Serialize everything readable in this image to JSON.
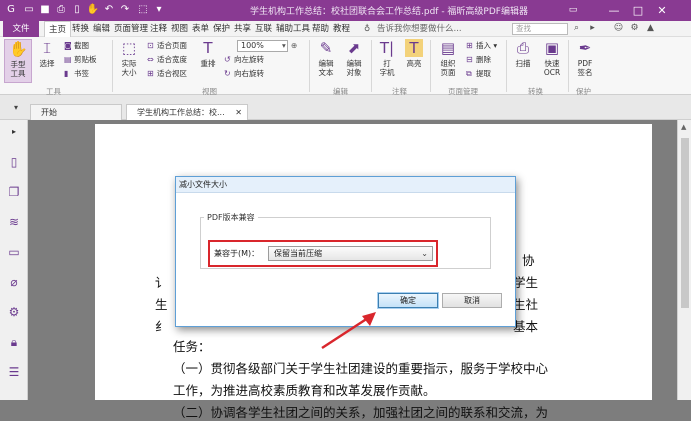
{
  "titlebar": {
    "title": "学生机构工作总结：校社团联合会工作总结.pdf - 福昕高级PDF编辑器",
    "minimize": "—",
    "maximize": "□",
    "close": "✕",
    "restore": "▭",
    "accent": "#893a92"
  },
  "menubar": {
    "file": "文件",
    "items": [
      "主页",
      "转换",
      "编辑",
      "页面管理",
      "注释",
      "视图",
      "表单",
      "保护",
      "共享",
      "互联",
      "辅助工具",
      "帮助",
      "教程"
    ],
    "tellme": "告诉我你想要做什么...",
    "search_placeholder": "查找"
  },
  "ribbon": {
    "hand_tool": "手型\n工具",
    "select": "选择",
    "screenshot": "截图",
    "clipboard": "剪贴板",
    "bookmark": "书签",
    "actual_size": "实际\n大小",
    "fit_page": "适合页面",
    "fit_width": "适合宽度",
    "fit_visible": "适合视区",
    "reflow": "重排",
    "zoom": "100%",
    "rotate_left": "向左旋转",
    "rotate_right": "向右旋转",
    "edit_text": "编辑\n文本",
    "edit_object": "编辑\n对象",
    "typewriter": "打\n字机",
    "highlight": "高亮",
    "organize_pages": "组织\n页面",
    "insert": "插入",
    "delete": "删除",
    "extract": "提取",
    "scan": "扫描",
    "quick_ocr": "快速\nOCR",
    "pdf_sign": "PDF\n签名",
    "groups": {
      "tools": "工具",
      "view": "视图",
      "edit": "编辑",
      "comment": "注释",
      "page_mgmt": "页面管理",
      "convert": "转换",
      "protect": "保护"
    }
  },
  "tabs": {
    "start": "开始",
    "document": "学生机构工作总结：校..."
  },
  "document": {
    "lines": [
      "协",
      "学生",
      "生社",
      "基本",
      "任务：",
      "（一）贯彻各级部门关于学生社团建设的重要指示，服务于学校中心",
      "工作，为推进高校素质教育和改革发展作贡献。",
      "（二）协调各学生社团之间的关系，加强社团之间的联系和交流，为"
    ],
    "left_fragments": [
      "讠",
      "生",
      "纟"
    ]
  },
  "dialog": {
    "title": "减小文件大小",
    "fieldset_label": "PDF版本兼容",
    "compat_label": "兼容于(M)：",
    "compat_value": "保留当前压缩",
    "ok": "确定",
    "cancel": "取消",
    "highlight_color": "#d9262c",
    "arrow_color": "#d9262c"
  }
}
